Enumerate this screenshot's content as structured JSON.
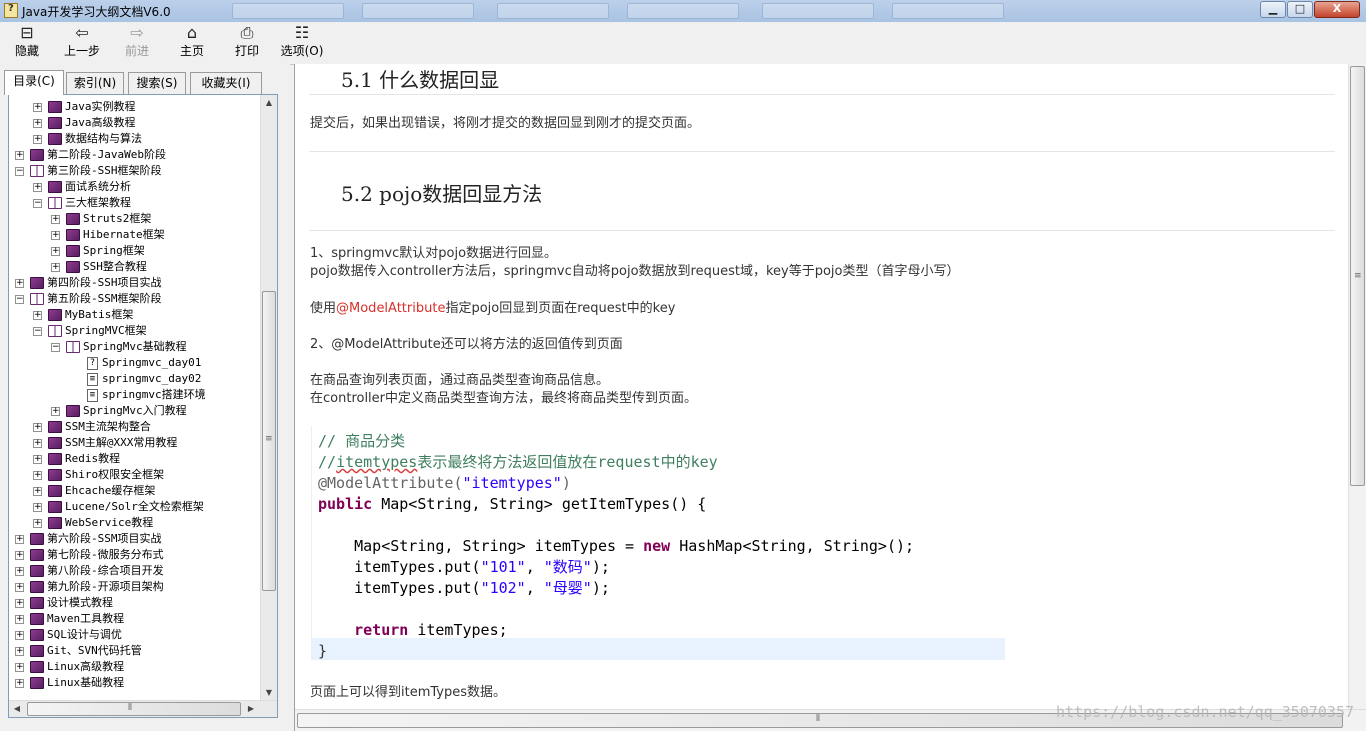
{
  "window": {
    "title": "Java开发学习大纲文档V6.0",
    "minimize": "▁",
    "maximize": "□",
    "close": "X"
  },
  "toolbar": {
    "hide": "隐藏",
    "back": "上一步",
    "forward": "前进",
    "home": "主页",
    "print": "打印",
    "options": "选项(O)"
  },
  "tabs": {
    "contents": "目录(C)",
    "index": "索引(N)",
    "search": "搜索(S)",
    "favorites": "收藏夹(I)"
  },
  "tree": [
    {
      "label": "Java实例教程",
      "expander": "+",
      "icon": "book"
    },
    {
      "label": "Java高级教程",
      "expander": "+",
      "icon": "book"
    },
    {
      "label": "数据结构与算法",
      "expander": "+",
      "icon": "book"
    },
    {
      "label": "第二阶段-JavaWeb阶段",
      "expander": "+",
      "icon": "book"
    },
    {
      "label": "第三阶段-SSH框架阶段",
      "expander": "−",
      "icon": "book-open"
    },
    {
      "label": "面试系统分析",
      "expander": "+",
      "icon": "book"
    },
    {
      "label": "三大框架教程",
      "expander": "−",
      "icon": "book-open"
    },
    {
      "label": "Struts2框架",
      "expander": "+",
      "icon": "book"
    },
    {
      "label": "Hibernate框架",
      "expander": "+",
      "icon": "book"
    },
    {
      "label": "Spring框架",
      "expander": "+",
      "icon": "book"
    },
    {
      "label": "SSH整合教程",
      "expander": "+",
      "icon": "book"
    },
    {
      "label": "第四阶段-SSH项目实战",
      "expander": "+",
      "icon": "book"
    },
    {
      "label": "第五阶段-SSM框架阶段",
      "expander": "−",
      "icon": "book-open"
    },
    {
      "label": "MyBatis框架",
      "expander": "+",
      "icon": "book"
    },
    {
      "label": "SpringMVC框架",
      "expander": "−",
      "icon": "book-open"
    },
    {
      "label": "SpringMvc基础教程",
      "expander": "−",
      "icon": "book-open"
    },
    {
      "label": "Springmvc_day01",
      "expander": "",
      "icon": "page-help"
    },
    {
      "label": "springmvc_day02",
      "expander": "",
      "icon": "page"
    },
    {
      "label": "springmvc搭建环境",
      "expander": "",
      "icon": "page"
    },
    {
      "label": "SpringMvc入门教程",
      "expander": "+",
      "icon": "book"
    },
    {
      "label": "SSM主流架构整合",
      "expander": "+",
      "icon": "book"
    },
    {
      "label": "SSM主解@XXX常用教程",
      "expander": "+",
      "icon": "book"
    },
    {
      "label": "Redis教程",
      "expander": "+",
      "icon": "book"
    },
    {
      "label": "Shiro权限安全框架",
      "expander": "+",
      "icon": "book"
    },
    {
      "label": "Ehcache缓存框架",
      "expander": "+",
      "icon": "book"
    },
    {
      "label": "Lucene/Solr全文检索框架",
      "expander": "+",
      "icon": "book"
    },
    {
      "label": "WebService教程",
      "expander": "+",
      "icon": "book"
    },
    {
      "label": "第六阶段-SSM项目实战",
      "expander": "+",
      "icon": "book"
    },
    {
      "label": "第七阶段-微服务分布式",
      "expander": "+",
      "icon": "book"
    },
    {
      "label": "第八阶段-综合项目开发",
      "expander": "+",
      "icon": "book"
    },
    {
      "label": "第九阶段-开源项目架构",
      "expander": "+",
      "icon": "book"
    },
    {
      "label": "设计模式教程",
      "expander": "+",
      "icon": "book"
    },
    {
      "label": "Maven工具教程",
      "expander": "+",
      "icon": "book"
    },
    {
      "label": "SQL设计与调优",
      "expander": "+",
      "icon": "book"
    },
    {
      "label": "Git、SVN代码托管",
      "expander": "+",
      "icon": "book"
    },
    {
      "label": "Linux高级教程",
      "expander": "+",
      "icon": "book"
    },
    {
      "label": "Linux基础教程",
      "expander": "+",
      "icon": "book"
    }
  ],
  "content": {
    "h_5_1": "5.1  什么数据回显",
    "p1": "提交后，如果出现错误，将刚才提交的数据回显到刚才的提交页面。",
    "h_5_2": "5.2  pojo数据回显方法",
    "p2": "1、springmvc默认对pojo数据进行回显。",
    "p3": "pojo数据传入controller方法后，springmvc自动将pojo数据放到request域，key等于pojo类型（首字母小写）",
    "p4_pre": "使用",
    "p4_anno": "@ModelAttribute",
    "p4_post": "指定pojo回显到页面在request中的key",
    "p5": "2、@ModelAttribute还可以将方法的返回值传到页面",
    "p6": "在商品查询列表页面，通过商品类型查询商品信息。",
    "p7": "在controller中定义商品类型查询方法，最终将商品类型传到页面。",
    "code": {
      "l1": "// 商品分类",
      "l2_a": "//",
      "l2_b": "itemtypes",
      "l2_c": "表示最终将方法返回值放在",
      "l2_d": "request",
      "l2_e": "中的",
      "l2_f": "key",
      "l3_ann": "@ModelAttribute(",
      "l3_str": "\"itemtypes\"",
      "l3_end": ")",
      "l4_kw": "public",
      "l4_rest": " Map<String, String> getItemTypes() {",
      "l5_a": "    Map<String, String> itemTypes = ",
      "l5_kw": "new",
      "l5_b": " HashMap<String, String>();",
      "l6_a": "    itemTypes.put(",
      "l6_s1": "\"101\"",
      "l6_c": ", ",
      "l6_s2": "\"数码\"",
      "l6_e": ");",
      "l7_a": "    itemTypes.put(",
      "l7_s1": "\"102\"",
      "l7_c": ", ",
      "l7_s2": "\"母婴\"",
      "l7_e": ");",
      "l8_kw": "    return",
      "l8_rest": " itemTypes;",
      "l9": "}"
    },
    "p8": "页面上可以得到itemTypes数据。"
  },
  "watermark": "https://blog.csdn.net/qq_35070357"
}
